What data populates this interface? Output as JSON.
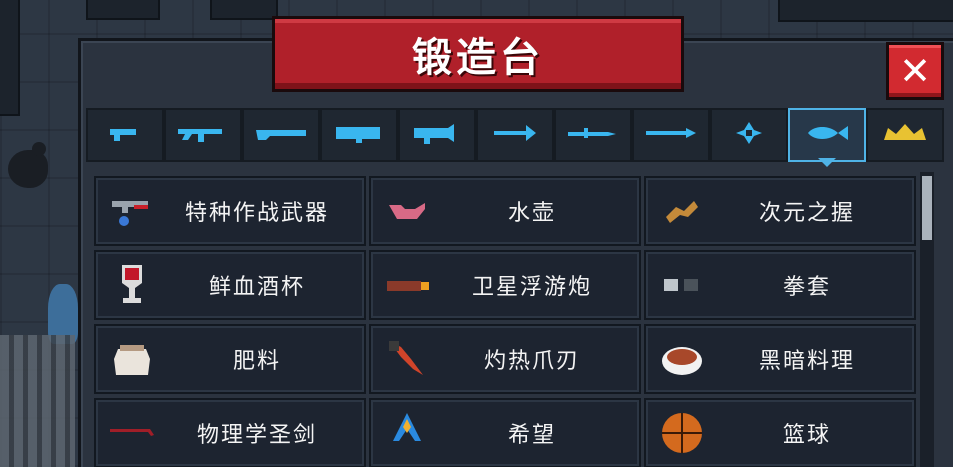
{
  "title": "锻造台",
  "close_label": "✕",
  "colors": {
    "accent_blue": "#4fb3e6",
    "banner_red": "#b0202a",
    "close_red": "#d22a30",
    "gold": "#e8c232"
  },
  "tabs": [
    {
      "icon": "pistol-icon",
      "selected": false
    },
    {
      "icon": "rifle-icon",
      "selected": false
    },
    {
      "icon": "shotgun-icon",
      "selected": false
    },
    {
      "icon": "launcher-icon",
      "selected": false
    },
    {
      "icon": "laser-gun-icon",
      "selected": false
    },
    {
      "icon": "bow-icon",
      "selected": false
    },
    {
      "icon": "sword-icon",
      "selected": false
    },
    {
      "icon": "spear-icon",
      "selected": false
    },
    {
      "icon": "shuriken-icon",
      "selected": false
    },
    {
      "icon": "fish-icon",
      "selected": true
    },
    {
      "icon": "crown-icon",
      "selected": false
    }
  ],
  "items": [
    {
      "label": "特种作战武器",
      "icon": "special-ops-weapon-icon"
    },
    {
      "label": "水壶",
      "icon": "kettle-icon"
    },
    {
      "label": "次元之握",
      "icon": "dimension-grip-icon"
    },
    {
      "label": "鲜血酒杯",
      "icon": "blood-goblet-icon"
    },
    {
      "label": "卫星浮游炮",
      "icon": "satellite-cannon-icon"
    },
    {
      "label": "拳套",
      "icon": "gauntlet-icon"
    },
    {
      "label": "肥料",
      "icon": "fertilizer-sack-icon"
    },
    {
      "label": "灼热爪刃",
      "icon": "burning-claw-icon"
    },
    {
      "label": "黑暗料理",
      "icon": "dark-cuisine-icon"
    },
    {
      "label": "物理学圣剑",
      "icon": "crowbar-icon"
    },
    {
      "label": "希望",
      "icon": "praying-hands-icon"
    },
    {
      "label": "篮球",
      "icon": "basketball-icon"
    }
  ],
  "scroll": {
    "position": 0.0
  }
}
